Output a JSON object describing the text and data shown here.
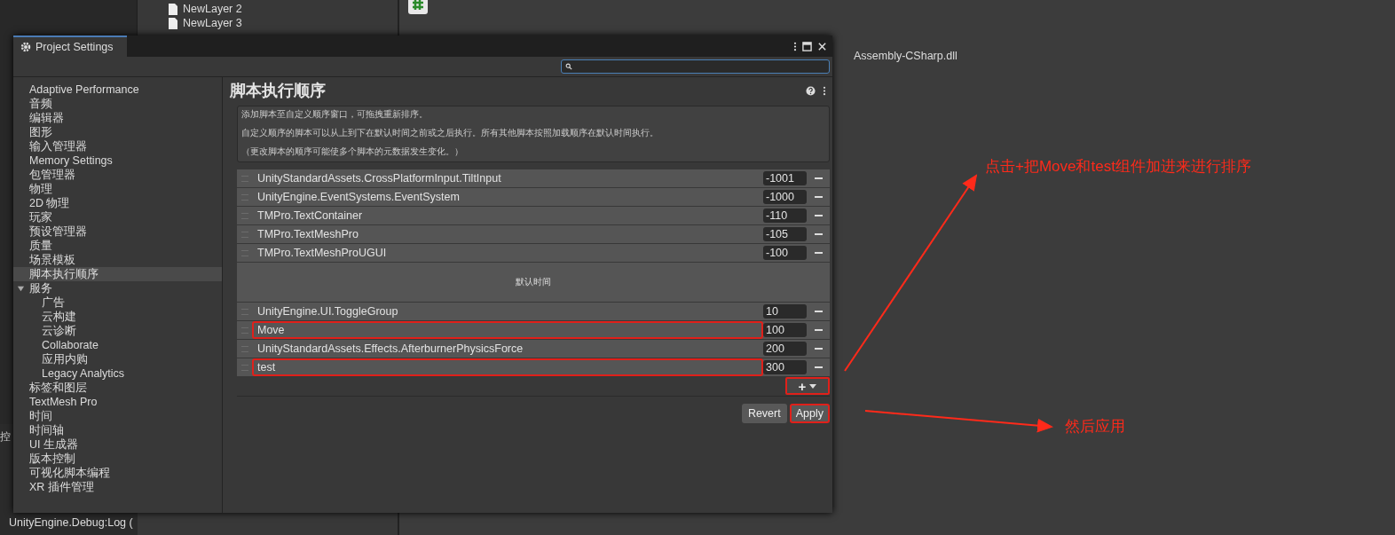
{
  "hierarchy": {
    "items": [
      "NewLayer 2",
      "NewLayer 3"
    ]
  },
  "inspector": {
    "file": "Assembly-CSharp.dll"
  },
  "console": {
    "label": "控",
    "log": "UnityEngine.Debug:Log ("
  },
  "window": {
    "title": "Project Settings",
    "heading": "脚本执行顺序",
    "sidebar": [
      {
        "label": "Adaptive Performance",
        "selected": false
      },
      {
        "label": "音频",
        "selected": false
      },
      {
        "label": "编辑器",
        "selected": false
      },
      {
        "label": "图形",
        "selected": false
      },
      {
        "label": "输入管理器",
        "selected": false
      },
      {
        "label": "Memory Settings",
        "selected": false
      },
      {
        "label": "包管理器",
        "selected": false
      },
      {
        "label": "物理",
        "selected": false
      },
      {
        "label": "2D 物理",
        "selected": false
      },
      {
        "label": "玩家",
        "selected": false
      },
      {
        "label": "预设管理器",
        "selected": false
      },
      {
        "label": "质量",
        "selected": false
      },
      {
        "label": "场景模板",
        "selected": false
      },
      {
        "label": "脚本执行顺序",
        "selected": true
      },
      {
        "label": "服务",
        "selected": false,
        "expanded": true,
        "children": [
          {
            "label": "广告",
            "selected": false
          },
          {
            "label": "云构建",
            "selected": false
          },
          {
            "label": "云诊断",
            "selected": false
          },
          {
            "label": "Collaborate",
            "selected": false
          },
          {
            "label": "应用内购",
            "selected": false
          },
          {
            "label": "Legacy Analytics",
            "selected": false
          }
        ]
      },
      {
        "label": "标签和图层",
        "selected": false
      },
      {
        "label": "TextMesh Pro",
        "selected": false
      },
      {
        "label": "时间",
        "selected": false
      },
      {
        "label": "时间轴",
        "selected": false
      },
      {
        "label": "UI 生成器",
        "selected": false
      },
      {
        "label": "版本控制",
        "selected": false
      },
      {
        "label": "可视化脚本编程",
        "selected": false
      },
      {
        "label": "XR 插件管理",
        "selected": false
      }
    ],
    "description": [
      "添加脚本至自定义顺序窗口，可拖拽重新排序。",
      "自定义顺序的脚本可以从上到下在默认时间之前或之后执行。所有其他脚本按照加载顺序在默认时间执行。",
      "（更改脚本的顺序可能使多个脚本的元数据发生变化。）"
    ],
    "before_default": [
      {
        "name": "UnityStandardAssets.CrossPlatformInput.TiltInput",
        "order": "-1001",
        "marked": false
      },
      {
        "name": "UnityEngine.EventSystems.EventSystem",
        "order": "-1000",
        "marked": false
      },
      {
        "name": "TMPro.TextContainer",
        "order": "-110",
        "marked": false
      },
      {
        "name": "TMPro.TextMeshPro",
        "order": "-105",
        "marked": false
      },
      {
        "name": "TMPro.TextMeshProUGUI",
        "order": "-100",
        "marked": false
      }
    ],
    "default_time": "默认时间",
    "after_default": [
      {
        "name": "UnityEngine.UI.ToggleGroup",
        "order": "10",
        "marked": false
      },
      {
        "name": "Move",
        "order": "100",
        "marked": true
      },
      {
        "name": "UnityStandardAssets.Effects.AfterburnerPhysicsForce",
        "order": "200",
        "marked": false
      },
      {
        "name": "test",
        "order": "300",
        "marked": true
      }
    ],
    "add_button": {
      "label": "+",
      "marked": true
    },
    "buttons": [
      {
        "label": "Revert",
        "marked": false
      },
      {
        "label": "Apply",
        "marked": true
      }
    ]
  },
  "annotations": [
    "点击+把Move和test组件加进来进行排序",
    "然后应用"
  ]
}
